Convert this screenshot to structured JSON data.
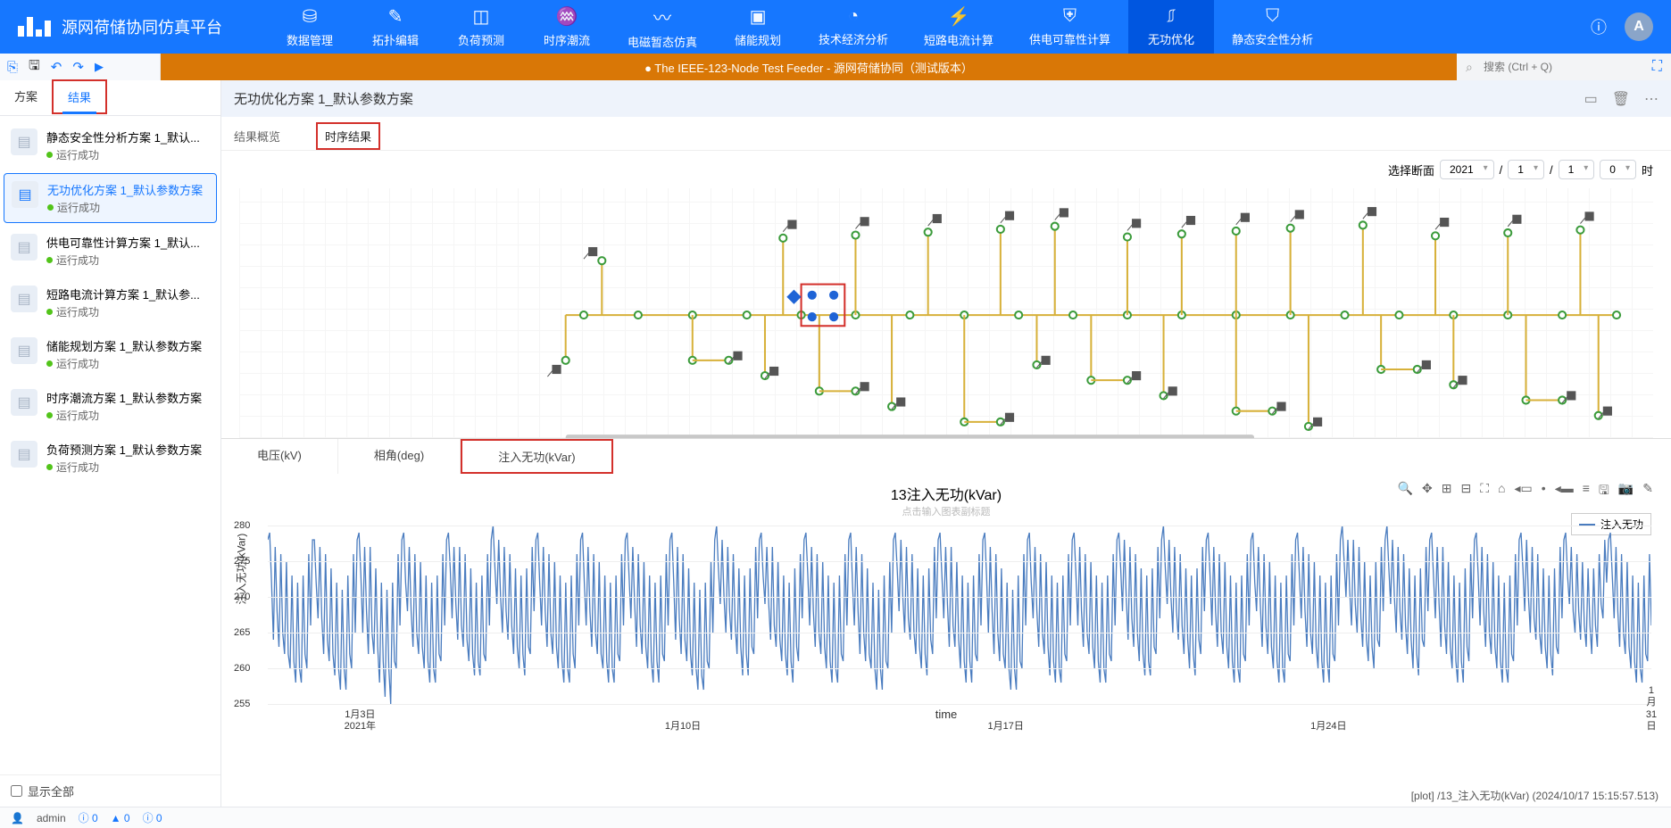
{
  "app_title": "源网荷储协同仿真平台",
  "nav_tabs": [
    {
      "label": "数据管理",
      "icon": "⛁"
    },
    {
      "label": "拓扑编辑",
      "icon": "✎"
    },
    {
      "label": "负荷预测",
      "icon": "◫"
    },
    {
      "label": "时序潮流",
      "icon": "♒"
    },
    {
      "label": "电磁暂态仿真",
      "icon": "〰"
    },
    {
      "label": "储能规划",
      "icon": "▣"
    },
    {
      "label": "技术经济分析",
      "icon": "◔"
    },
    {
      "label": "短路电流计算",
      "icon": "⚡"
    },
    {
      "label": "供电可靠性计算",
      "icon": "⛨"
    },
    {
      "label": "无功优化",
      "icon": "⎎",
      "active": true
    },
    {
      "label": "静态安全性分析",
      "icon": "⛉"
    }
  ],
  "avatar": "A",
  "toolbar_center": "● The IEEE-123-Node Test Feeder - 源网荷储协同（测试版本）",
  "search_placeholder": "搜索 (Ctrl + Q)",
  "left_tabs": [
    {
      "label": "方案"
    },
    {
      "label": "结果",
      "active": true
    }
  ],
  "plans": [
    {
      "title": "静态安全性分析方案 1_默认...",
      "status": "运行成功"
    },
    {
      "title": "无功优化方案 1_默认参数方案",
      "status": "运行成功",
      "active": true
    },
    {
      "title": "供电可靠性计算方案 1_默认...",
      "status": "运行成功"
    },
    {
      "title": "短路电流计算方案 1_默认参...",
      "status": "运行成功"
    },
    {
      "title": "储能规划方案 1_默认参数方案",
      "status": "运行成功"
    },
    {
      "title": "时序潮流方案 1_默认参数方案",
      "status": "运行成功"
    },
    {
      "title": "负荷预测方案 1_默认参数方案",
      "status": "运行成功"
    }
  ],
  "show_all_label": "显示全部",
  "rt_title": "无功优化方案 1_默认参数方案",
  "sub_tabs": [
    {
      "label": "结果概览"
    },
    {
      "label": "时序结果",
      "active": true
    }
  ],
  "cross_label": "选择断面",
  "cross_time_suffix": "时",
  "selects": {
    "year": "2021",
    "month": "1",
    "day": "1",
    "hour": "0"
  },
  "chart_tabs": [
    {
      "label": "电压(kV)"
    },
    {
      "label": "相角(deg)"
    },
    {
      "label": "注入无功(kVar)",
      "active": true
    }
  ],
  "chart_subtitle_placeholder": "点击输入图表副标题",
  "legend_label": "注入无功",
  "chart_data": {
    "type": "line",
    "title": "13注入无功(kVar)",
    "ylabel": "注入无功(kVar)",
    "xlabel": "time",
    "ylim": [
      255,
      280
    ],
    "yticks": [
      255,
      260,
      265,
      270,
      275,
      280
    ],
    "xticks": [
      "1月3日\n2021年",
      "1月10日",
      "1月17日",
      "1月24日",
      "1月31日"
    ],
    "x_range_days": [
      1,
      31
    ],
    "series": [
      {
        "name": "注入无功",
        "values": [
          278,
          279,
          272,
          264,
          277,
          268,
          263,
          276,
          265,
          262,
          275,
          262,
          260,
          273,
          261,
          258,
          272,
          260,
          258,
          273,
          262,
          260,
          276,
          266,
          278,
          278,
          272,
          267,
          277,
          267,
          262,
          276,
          264,
          261,
          274,
          262,
          259,
          272,
          260,
          257,
          271,
          260,
          257,
          273,
          262,
          260,
          276,
          265,
          278,
          279,
          273,
          265,
          277,
          268,
          262,
          277,
          265,
          262,
          274,
          263,
          258,
          272,
          261,
          256,
          271,
          260,
          255,
          272,
          261,
          260,
          276,
          266,
          278,
          279,
          272,
          268,
          277,
          268,
          263,
          276,
          265,
          262,
          275,
          263,
          260,
          273,
          261,
          258,
          272,
          260,
          258,
          273,
          262,
          261,
          276,
          266,
          278,
          279,
          274,
          267,
          277,
          269,
          264,
          277,
          266,
          263,
          276,
          264,
          261,
          274,
          262,
          259,
          272,
          261,
          259,
          273,
          262,
          261,
          276,
          266,
          278,
          280,
          274,
          269,
          278,
          270,
          265,
          277,
          268,
          264,
          276,
          266,
          262,
          274,
          263,
          260,
          273,
          262,
          259,
          274,
          263,
          262,
          277,
          268,
          278,
          279,
          272,
          266,
          277,
          268,
          263,
          276,
          265,
          262,
          275,
          263,
          260,
          273,
          261,
          258,
          272,
          260,
          258,
          273,
          262,
          260,
          276,
          266,
          278,
          279,
          272,
          266,
          277,
          268,
          263,
          276,
          265,
          262,
          275,
          262,
          260,
          273,
          261,
          258,
          272,
          260,
          258,
          273,
          262,
          261,
          276,
          266,
          278,
          279,
          273,
          267,
          277,
          269,
          263,
          276,
          266,
          262,
          275,
          263,
          260,
          273,
          261,
          258,
          272,
          261,
          258,
          273,
          262,
          261,
          276,
          266,
          278,
          279,
          272,
          264,
          277,
          267,
          262,
          276,
          264,
          261,
          274,
          262,
          259,
          272,
          260,
          257,
          271,
          259,
          257,
          272,
          261,
          260,
          275,
          265,
          278,
          280,
          274,
          269,
          278,
          270,
          265,
          277,
          268,
          264,
          276,
          266,
          262,
          274,
          263,
          259,
          273,
          262,
          259,
          274,
          263,
          262,
          277,
          267,
          278,
          279,
          273,
          269,
          277,
          269,
          264,
          277,
          266,
          263,
          275,
          264,
          261,
          273,
          262,
          259,
          272,
          261,
          258,
          274,
          263,
          261,
          276,
          267,
          278,
          279,
          273,
          266,
          277,
          268,
          263,
          276,
          265,
          262,
          275,
          263,
          260,
          273,
          261,
          258,
          272,
          260,
          258,
          273,
          262,
          261,
          276,
          266,
          278,
          279,
          272,
          266,
          277,
          268,
          262,
          276,
          265,
          261,
          274,
          262,
          260,
          272,
          260,
          257,
          271,
          260,
          257,
          273,
          261,
          260,
          275,
          265,
          278,
          279,
          274,
          268,
          278,
          270,
          265,
          277,
          267,
          264,
          276,
          265,
          262,
          274,
          263,
          260,
          273,
          262,
          259,
          274,
          264,
          262,
          277,
          267,
          278,
          279,
          273,
          267,
          277,
          269,
          263,
          277,
          266,
          263,
          275,
          264,
          260,
          273,
          261,
          258,
          272,
          261,
          258,
          273,
          262,
          261,
          276,
          266,
          278,
          279,
          273,
          265,
          277,
          268,
          262,
          276,
          265,
          261,
          274,
          262,
          260,
          272,
          260,
          257,
          271,
          260,
          257,
          273,
          261,
          260,
          276,
          266,
          278,
          279,
          272,
          267,
          277,
          268,
          263,
          276,
          265,
          262,
          275,
          263,
          259,
          273,
          261,
          258,
          272,
          260,
          258,
          273,
          262,
          261,
          276,
          266,
          278,
          279,
          273,
          266,
          277,
          268,
          263,
          276,
          265,
          262,
          275,
          263,
          260,
          273,
          261,
          258,
          272,
          260,
          258,
          273,
          262,
          261,
          276,
          266,
          278,
          279,
          274,
          268,
          278,
          270,
          264,
          277,
          267,
          263,
          276,
          265,
          261,
          274,
          262,
          259,
          273,
          261,
          259,
          274,
          263,
          262,
          277,
          267,
          278,
          280,
          274,
          269,
          278,
          270,
          265,
          277,
          268,
          264,
          276,
          266,
          262,
          274,
          264,
          260,
          273,
          262,
          259,
          274,
          264,
          262,
          277,
          268,
          278,
          279,
          273,
          266,
          277,
          268,
          263,
          276,
          265,
          262,
          275,
          263,
          260,
          273,
          261,
          258,
          272,
          260,
          258,
          273,
          262,
          261,
          276,
          266,
          278,
          279,
          272,
          268,
          277,
          269,
          263,
          276,
          266,
          262,
          275,
          263,
          260,
          273,
          261,
          258,
          272,
          260,
          258,
          273,
          262,
          261,
          276,
          266,
          278,
          279,
          273,
          267,
          277,
          268,
          263,
          276,
          265,
          262,
          275,
          263,
          260,
          273,
          261,
          258,
          272,
          261,
          258,
          273,
          262,
          261,
          276,
          266,
          278,
          280,
          275,
          270,
          278,
          271,
          266,
          278,
          269,
          265,
          277,
          267,
          263,
          275,
          264,
          261,
          273,
          263,
          260,
          275,
          264,
          263,
          277,
          268,
          278,
          280,
          274,
          269,
          278,
          270,
          265,
          277,
          268,
          264,
          276,
          266,
          262,
          274,
          264,
          260,
          273,
          262,
          259,
          274,
          264,
          263,
          277,
          268,
          278,
          279,
          273,
          267,
          277,
          269,
          263,
          277,
          266,
          262,
          275,
          263,
          260,
          273,
          261,
          258,
          272,
          261,
          258,
          274,
          263,
          261,
          276,
          267,
          278,
          279,
          273,
          266,
          277,
          268,
          263,
          276,
          265,
          262,
          275,
          263,
          260,
          273,
          261,
          258,
          272,
          260,
          258,
          273,
          262,
          261,
          276,
          266,
          278,
          279,
          274,
          268,
          278,
          270,
          265,
          277,
          267,
          264,
          276,
          265,
          262,
          274,
          263,
          260,
          273,
          262,
          259,
          274,
          263,
          262,
          277,
          267,
          278,
          279,
          273,
          269,
          277,
          268,
          265,
          276,
          268,
          264,
          275,
          266,
          263,
          274,
          266,
          262,
          274,
          266,
          263,
          276,
          269,
          267,
          278,
          272,
          278,
          279,
          273,
          267,
          277,
          268,
          263,
          276,
          265,
          262,
          275,
          263,
          260,
          273,
          261,
          258,
          272,
          260,
          258,
          273,
          262,
          261,
          276,
          266
        ]
      }
    ]
  },
  "bottom_info": "[plot] /13_注入无功(kVar) (2024/10/17 15:15:57.513)",
  "status": {
    "user": "admin",
    "info_count": "0",
    "warn_count": "0",
    "err_count": "0"
  }
}
